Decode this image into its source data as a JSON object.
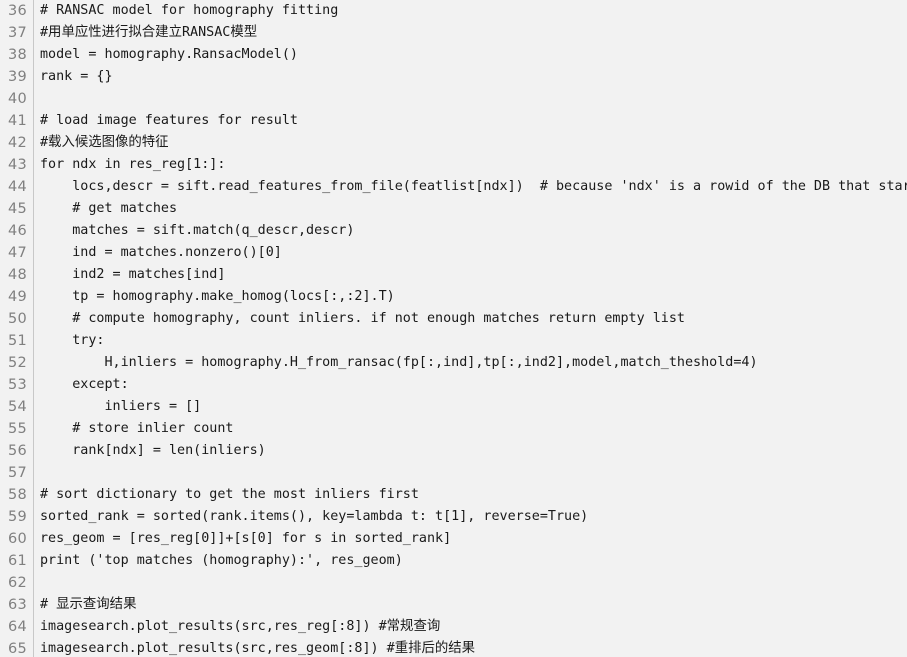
{
  "editor": {
    "language": "python",
    "font_family_hint": "monospace",
    "colors": {
      "background": "#f2f2f2",
      "text": "#1a1a1a",
      "line_number": "#808080",
      "gutter_separator": "#c8c8c8"
    },
    "first_visible_line": 36,
    "last_visible_line": 65,
    "lines": [
      {
        "number": "36",
        "text": "# RANSAC model for homography fitting"
      },
      {
        "number": "37",
        "text": "#用单应性进行拟合建立RANSAC模型"
      },
      {
        "number": "38",
        "text": "model = homography.RansacModel()"
      },
      {
        "number": "39",
        "text": "rank = {}"
      },
      {
        "number": "40",
        "text": ""
      },
      {
        "number": "41",
        "text": "# load image features for result"
      },
      {
        "number": "42",
        "text": "#载入候选图像的特征"
      },
      {
        "number": "43",
        "text": "for ndx in res_reg[1:]:"
      },
      {
        "number": "44",
        "text": "    locs,descr = sift.read_features_from_file(featlist[ndx])  # because 'ndx' is a rowid of the DB that star"
      },
      {
        "number": "45",
        "text": "    # get matches"
      },
      {
        "number": "46",
        "text": "    matches = sift.match(q_descr,descr)"
      },
      {
        "number": "47",
        "text": "    ind = matches.nonzero()[0]"
      },
      {
        "number": "48",
        "text": "    ind2 = matches[ind]"
      },
      {
        "number": "49",
        "text": "    tp = homography.make_homog(locs[:,:2].T)"
      },
      {
        "number": "50",
        "text": "    # compute homography, count inliers. if not enough matches return empty list"
      },
      {
        "number": "51",
        "text": "    try:"
      },
      {
        "number": "52",
        "text": "        H,inliers = homography.H_from_ransac(fp[:,ind],tp[:,ind2],model,match_theshold=4)"
      },
      {
        "number": "53",
        "text": "    except:"
      },
      {
        "number": "54",
        "text": "        inliers = []"
      },
      {
        "number": "55",
        "text": "    # store inlier count"
      },
      {
        "number": "56",
        "text": "    rank[ndx] = len(inliers)"
      },
      {
        "number": "57",
        "text": ""
      },
      {
        "number": "58",
        "text": "# sort dictionary to get the most inliers first"
      },
      {
        "number": "59",
        "text": "sorted_rank = sorted(rank.items(), key=lambda t: t[1], reverse=True)"
      },
      {
        "number": "60",
        "text": "res_geom = [res_reg[0]]+[s[0] for s in sorted_rank]"
      },
      {
        "number": "61",
        "text": "print ('top matches (homography):', res_geom)"
      },
      {
        "number": "62",
        "text": ""
      },
      {
        "number": "63",
        "text": "# 显示查询结果"
      },
      {
        "number": "64",
        "text": "imagesearch.plot_results(src,res_reg[:8]) #常规查询"
      },
      {
        "number": "65",
        "text": "imagesearch.plot_results(src,res_geom[:8]) #重排后的结果"
      }
    ]
  }
}
